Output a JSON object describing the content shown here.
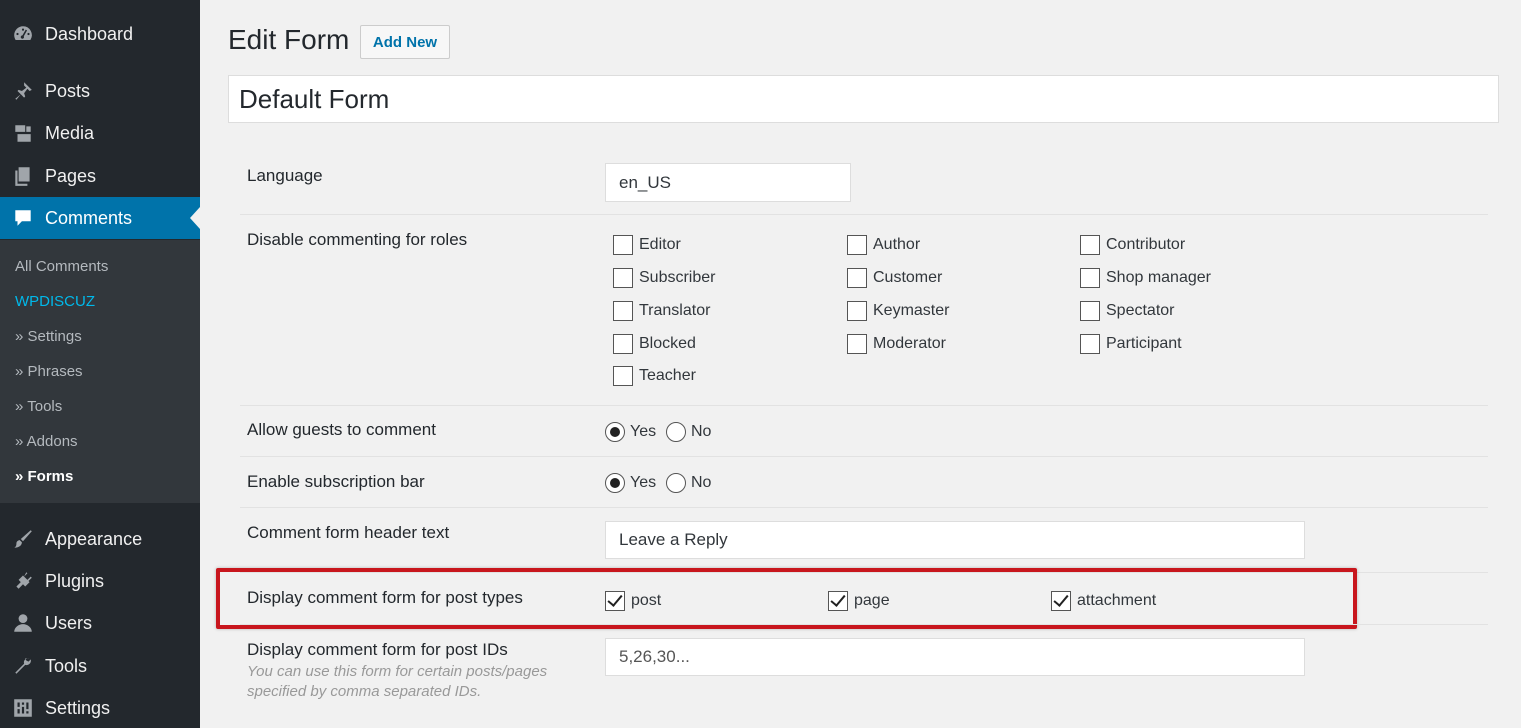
{
  "sidebar": {
    "menu": [
      {
        "label": "Dashboard",
        "icon": "dashboard-icon"
      },
      {
        "label": "Posts",
        "icon": "pin-icon"
      },
      {
        "label": "Media",
        "icon": "media-icon"
      },
      {
        "label": "Pages",
        "icon": "pages-icon"
      },
      {
        "label": "Comments",
        "icon": "comment-icon"
      },
      {
        "label": "Appearance",
        "icon": "brush-icon"
      },
      {
        "label": "Plugins",
        "icon": "plugin-icon"
      },
      {
        "label": "Users",
        "icon": "user-icon"
      },
      {
        "label": "Tools",
        "icon": "wrench-icon"
      },
      {
        "label": "Settings",
        "icon": "settings-icon"
      }
    ],
    "submenu": [
      "All Comments",
      "WPDISCUZ",
      "» Settings",
      "» Phrases",
      "» Tools",
      "» Addons",
      "» Forms"
    ]
  },
  "header": {
    "title": "Edit Form",
    "add_new": "Add New"
  },
  "form_title": "Default Form",
  "fields": {
    "language": {
      "label": "Language",
      "value": "en_US"
    },
    "disable_roles": {
      "label": "Disable commenting for roles",
      "roles": [
        "Editor",
        "Author",
        "Contributor",
        "Subscriber",
        "Customer",
        "Shop manager",
        "Translator",
        "Keymaster",
        "Spectator",
        "Blocked",
        "Moderator",
        "Participant",
        "Teacher"
      ]
    },
    "allow_guests": {
      "label": "Allow guests to comment",
      "yes": "Yes",
      "no": "No",
      "selected": "Yes"
    },
    "subscription_bar": {
      "label": "Enable subscription bar",
      "yes": "Yes",
      "no": "No",
      "selected": "Yes"
    },
    "header_text": {
      "label": "Comment form header text",
      "value": "Leave a Reply"
    },
    "post_types": {
      "label": "Display comment form for post types",
      "types": [
        "post",
        "page",
        "attachment"
      ],
      "checked": [
        true,
        true,
        true
      ]
    },
    "post_ids": {
      "label": "Display comment form for post IDs",
      "placeholder": "5,26,30...",
      "hint": "You can use this form for certain posts/pages specified by comma separated IDs."
    }
  },
  "colors": {
    "sidebar_bg": "#23282d",
    "submenu_bg": "#32373c",
    "accent": "#0073aa",
    "highlight": "#c8161d",
    "wpdiscuz": "#00b9eb"
  }
}
